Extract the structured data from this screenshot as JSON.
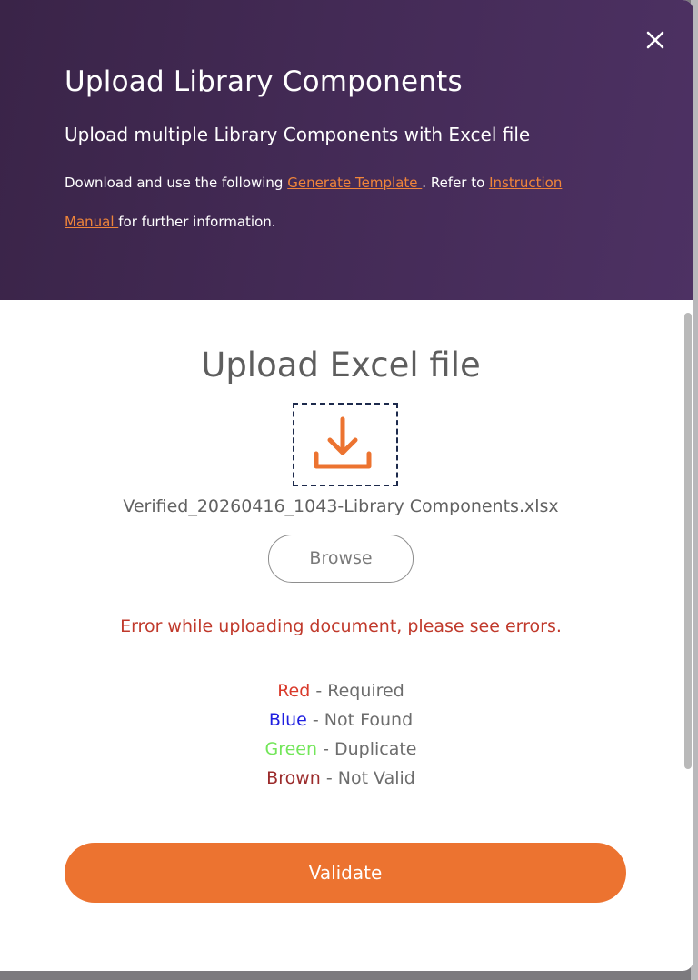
{
  "header": {
    "title": "Upload Library Components",
    "subtitle": "Upload multiple Library Components with Excel file",
    "desc_prefix": "Download and use the following ",
    "template_link": "Generate Template ",
    "desc_middle": ". Refer to ",
    "manual_link": "Instruction Manual ",
    "desc_suffix": "for further information.",
    "close_icon": "close-icon"
  },
  "upload": {
    "title": "Upload Excel file",
    "drop_icon": "download-icon",
    "file_name": "Verified_20260416_1043-Library Components.xlsx",
    "browse_label": "Browse"
  },
  "error": {
    "message": "Error while uploading document, please see errors."
  },
  "legend": [
    {
      "color_name": "Red",
      "desc": " - Required",
      "color": "#d93a2b"
    },
    {
      "color_name": "Blue",
      "desc": " - Not Found",
      "color": "#1f1fe0"
    },
    {
      "color_name": "Green",
      "desc": " - Duplicate",
      "color": "#73e65a"
    },
    {
      "color_name": "Brown",
      "desc": " - Not Valid",
      "color": "#9b2b2b"
    }
  ],
  "actions": {
    "validate_label": "Validate"
  },
  "colors": {
    "accent": "#ec7330",
    "header_bg": "#432a55",
    "error": "#c0392b",
    "link": "#f0853a"
  }
}
